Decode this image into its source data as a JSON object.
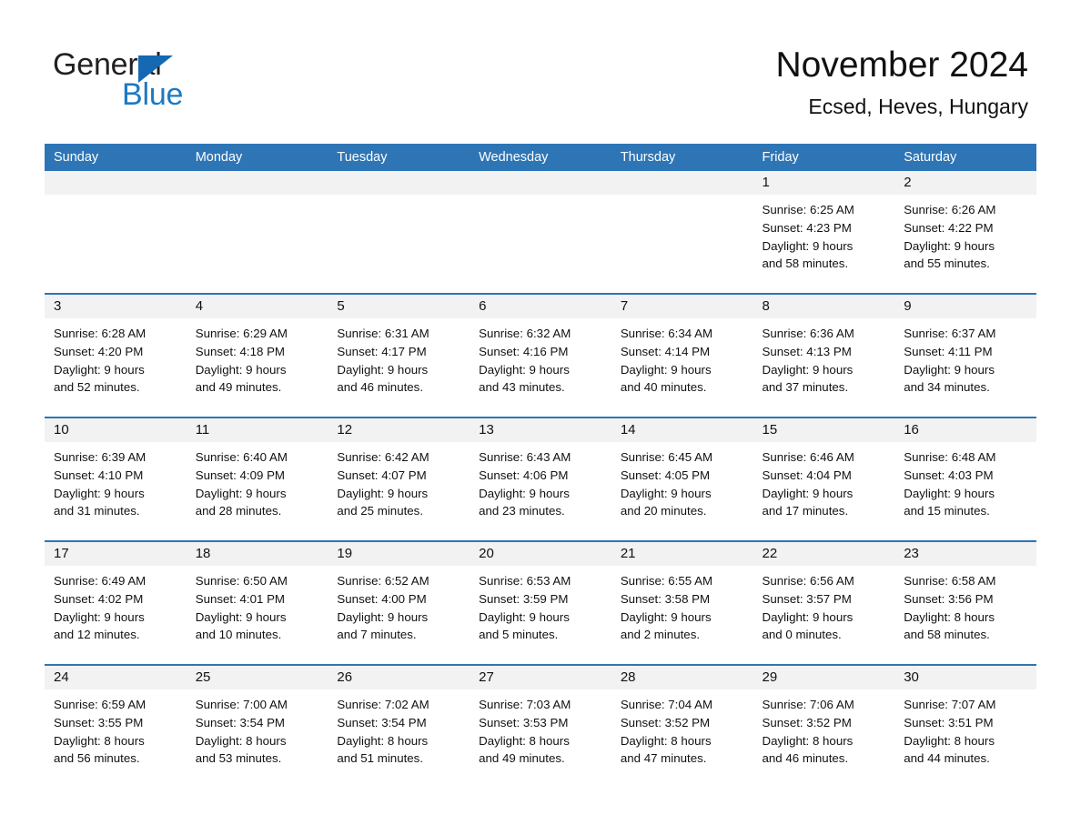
{
  "brand": {
    "name_part1": "General",
    "name_part2": "Blue",
    "triangle_color": "#1469b2",
    "blue_text_color": "#1b79c4"
  },
  "header": {
    "title": "November 2024",
    "subtitle": "Ecsed, Heves, Hungary"
  },
  "theme": {
    "header_blue": "#2e75b6",
    "daynum_band_gray": "#f2f2f2",
    "row_divider_blue": "#2e75b6",
    "text_color": "#111111"
  },
  "weekday_headers": [
    "Sunday",
    "Monday",
    "Tuesday",
    "Wednesday",
    "Thursday",
    "Friday",
    "Saturday"
  ],
  "weeks": [
    [
      {
        "day": "",
        "empty": true
      },
      {
        "day": "",
        "empty": true
      },
      {
        "day": "",
        "empty": true
      },
      {
        "day": "",
        "empty": true
      },
      {
        "day": "",
        "empty": true
      },
      {
        "day": "1",
        "sunrise": "Sunrise: 6:25 AM",
        "sunset": "Sunset: 4:23 PM",
        "daylight_line1": "Daylight: 9 hours",
        "daylight_line2": "and 58 minutes."
      },
      {
        "day": "2",
        "sunrise": "Sunrise: 6:26 AM",
        "sunset": "Sunset: 4:22 PM",
        "daylight_line1": "Daylight: 9 hours",
        "daylight_line2": "and 55 minutes."
      }
    ],
    [
      {
        "day": "3",
        "sunrise": "Sunrise: 6:28 AM",
        "sunset": "Sunset: 4:20 PM",
        "daylight_line1": "Daylight: 9 hours",
        "daylight_line2": "and 52 minutes."
      },
      {
        "day": "4",
        "sunrise": "Sunrise: 6:29 AM",
        "sunset": "Sunset: 4:18 PM",
        "daylight_line1": "Daylight: 9 hours",
        "daylight_line2": "and 49 minutes."
      },
      {
        "day": "5",
        "sunrise": "Sunrise: 6:31 AM",
        "sunset": "Sunset: 4:17 PM",
        "daylight_line1": "Daylight: 9 hours",
        "daylight_line2": "and 46 minutes."
      },
      {
        "day": "6",
        "sunrise": "Sunrise: 6:32 AM",
        "sunset": "Sunset: 4:16 PM",
        "daylight_line1": "Daylight: 9 hours",
        "daylight_line2": "and 43 minutes."
      },
      {
        "day": "7",
        "sunrise": "Sunrise: 6:34 AM",
        "sunset": "Sunset: 4:14 PM",
        "daylight_line1": "Daylight: 9 hours",
        "daylight_line2": "and 40 minutes."
      },
      {
        "day": "8",
        "sunrise": "Sunrise: 6:36 AM",
        "sunset": "Sunset: 4:13 PM",
        "daylight_line1": "Daylight: 9 hours",
        "daylight_line2": "and 37 minutes."
      },
      {
        "day": "9",
        "sunrise": "Sunrise: 6:37 AM",
        "sunset": "Sunset: 4:11 PM",
        "daylight_line1": "Daylight: 9 hours",
        "daylight_line2": "and 34 minutes."
      }
    ],
    [
      {
        "day": "10",
        "sunrise": "Sunrise: 6:39 AM",
        "sunset": "Sunset: 4:10 PM",
        "daylight_line1": "Daylight: 9 hours",
        "daylight_line2": "and 31 minutes."
      },
      {
        "day": "11",
        "sunrise": "Sunrise: 6:40 AM",
        "sunset": "Sunset: 4:09 PM",
        "daylight_line1": "Daylight: 9 hours",
        "daylight_line2": "and 28 minutes."
      },
      {
        "day": "12",
        "sunrise": "Sunrise: 6:42 AM",
        "sunset": "Sunset: 4:07 PM",
        "daylight_line1": "Daylight: 9 hours",
        "daylight_line2": "and 25 minutes."
      },
      {
        "day": "13",
        "sunrise": "Sunrise: 6:43 AM",
        "sunset": "Sunset: 4:06 PM",
        "daylight_line1": "Daylight: 9 hours",
        "daylight_line2": "and 23 minutes."
      },
      {
        "day": "14",
        "sunrise": "Sunrise: 6:45 AM",
        "sunset": "Sunset: 4:05 PM",
        "daylight_line1": "Daylight: 9 hours",
        "daylight_line2": "and 20 minutes."
      },
      {
        "day": "15",
        "sunrise": "Sunrise: 6:46 AM",
        "sunset": "Sunset: 4:04 PM",
        "daylight_line1": "Daylight: 9 hours",
        "daylight_line2": "and 17 minutes."
      },
      {
        "day": "16",
        "sunrise": "Sunrise: 6:48 AM",
        "sunset": "Sunset: 4:03 PM",
        "daylight_line1": "Daylight: 9 hours",
        "daylight_line2": "and 15 minutes."
      }
    ],
    [
      {
        "day": "17",
        "sunrise": "Sunrise: 6:49 AM",
        "sunset": "Sunset: 4:02 PM",
        "daylight_line1": "Daylight: 9 hours",
        "daylight_line2": "and 12 minutes."
      },
      {
        "day": "18",
        "sunrise": "Sunrise: 6:50 AM",
        "sunset": "Sunset: 4:01 PM",
        "daylight_line1": "Daylight: 9 hours",
        "daylight_line2": "and 10 minutes."
      },
      {
        "day": "19",
        "sunrise": "Sunrise: 6:52 AM",
        "sunset": "Sunset: 4:00 PM",
        "daylight_line1": "Daylight: 9 hours",
        "daylight_line2": "and 7 minutes."
      },
      {
        "day": "20",
        "sunrise": "Sunrise: 6:53 AM",
        "sunset": "Sunset: 3:59 PM",
        "daylight_line1": "Daylight: 9 hours",
        "daylight_line2": "and 5 minutes."
      },
      {
        "day": "21",
        "sunrise": "Sunrise: 6:55 AM",
        "sunset": "Sunset: 3:58 PM",
        "daylight_line1": "Daylight: 9 hours",
        "daylight_line2": "and 2 minutes."
      },
      {
        "day": "22",
        "sunrise": "Sunrise: 6:56 AM",
        "sunset": "Sunset: 3:57 PM",
        "daylight_line1": "Daylight: 9 hours",
        "daylight_line2": "and 0 minutes."
      },
      {
        "day": "23",
        "sunrise": "Sunrise: 6:58 AM",
        "sunset": "Sunset: 3:56 PM",
        "daylight_line1": "Daylight: 8 hours",
        "daylight_line2": "and 58 minutes."
      }
    ],
    [
      {
        "day": "24",
        "sunrise": "Sunrise: 6:59 AM",
        "sunset": "Sunset: 3:55 PM",
        "daylight_line1": "Daylight: 8 hours",
        "daylight_line2": "and 56 minutes."
      },
      {
        "day": "25",
        "sunrise": "Sunrise: 7:00 AM",
        "sunset": "Sunset: 3:54 PM",
        "daylight_line1": "Daylight: 8 hours",
        "daylight_line2": "and 53 minutes."
      },
      {
        "day": "26",
        "sunrise": "Sunrise: 7:02 AM",
        "sunset": "Sunset: 3:54 PM",
        "daylight_line1": "Daylight: 8 hours",
        "daylight_line2": "and 51 minutes."
      },
      {
        "day": "27",
        "sunrise": "Sunrise: 7:03 AM",
        "sunset": "Sunset: 3:53 PM",
        "daylight_line1": "Daylight: 8 hours",
        "daylight_line2": "and 49 minutes."
      },
      {
        "day": "28",
        "sunrise": "Sunrise: 7:04 AM",
        "sunset": "Sunset: 3:52 PM",
        "daylight_line1": "Daylight: 8 hours",
        "daylight_line2": "and 47 minutes."
      },
      {
        "day": "29",
        "sunrise": "Sunrise: 7:06 AM",
        "sunset": "Sunset: 3:52 PM",
        "daylight_line1": "Daylight: 8 hours",
        "daylight_line2": "and 46 minutes."
      },
      {
        "day": "30",
        "sunrise": "Sunrise: 7:07 AM",
        "sunset": "Sunset: 3:51 PM",
        "daylight_line1": "Daylight: 8 hours",
        "daylight_line2": "and 44 minutes."
      }
    ]
  ]
}
